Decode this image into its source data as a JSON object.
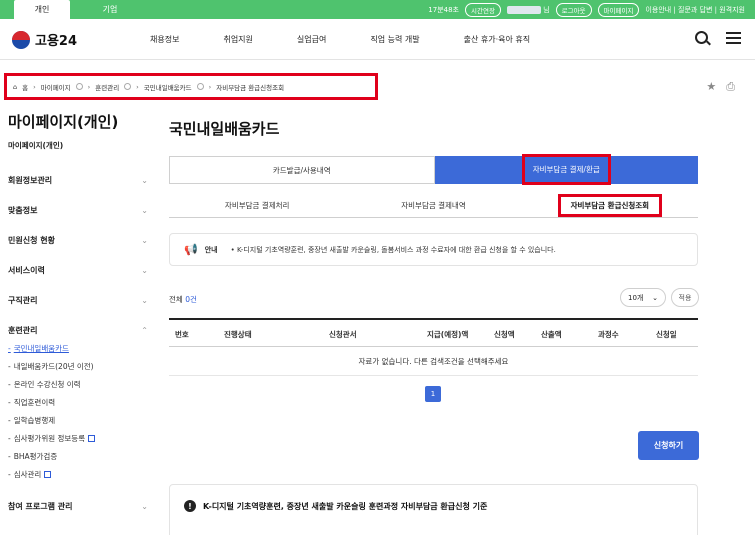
{
  "topbar": {
    "tab_personal": "개인",
    "tab_company": "기업",
    "time_text": "17분48초",
    "extend_label": "시간연장",
    "user_suffix": "님",
    "logout_label": "로그아웃",
    "mypage_label": "마이페이지",
    "links": "이용안내 | 질문과 답변 | 원격지원"
  },
  "header": {
    "logo_text": "고용24",
    "nav": [
      "채용정보",
      "취업지원",
      "실업급여",
      "직업 능력 개발",
      "출산 휴가·육아 휴직"
    ]
  },
  "breadcrumb": {
    "home": "홈",
    "items": [
      "마이페이지",
      "훈련관리",
      "국민내일배움카드",
      "자비부담금 환급신청조회"
    ]
  },
  "sidebar": {
    "title": "마이페이지(개인)",
    "subtitle": "마이페이지(개인)",
    "menu": [
      "회원정보관리",
      "맞춤정보",
      "민원신청 현황",
      "서비스이력",
      "구직관리",
      "훈련관리"
    ],
    "training_items": [
      "국민내일배움카드",
      "내일배움카드(20년 이전)",
      "온라인 수강신청 이력",
      "직업훈련이력",
      "일학습병행제",
      "심사평가위원 정보등록",
      "BHA평가검증",
      "심사관리"
    ],
    "last_menu": "참여 프로그램 관리"
  },
  "main": {
    "title": "국민내일배움카드",
    "seg_tabs": [
      "카드발급/사용내역",
      "자비부담금 결제/환급"
    ],
    "sub_tabs": [
      "자비부담금 결제처리",
      "자비부담금 결제내역",
      "자비부담금 환급신청조회"
    ],
    "notice_label": "안내",
    "notice_text": "• K-디지털 기초역량훈련, 중장년 새출발 카운슬링, 돌봄서비스 과정 수료자에 대한 환급 신청을 할 수 있습니다.",
    "count_prefix": "전체",
    "count_value": "0건",
    "page_size": "10개",
    "apply_label": "적용",
    "columns": [
      "번호",
      "진행상태",
      "신청관서",
      "지급(예정)액",
      "신청액",
      "산출액",
      "과정수",
      "신청일"
    ],
    "empty_text": "자료가 없습니다. 다른 검색조건을 선택해주세요",
    "page": "1",
    "apply_button": "신청하기",
    "criteria_title": "K-디지털 기초역량훈련, 중장년 새출발 카운슬링 훈련과정 자비부담금 환급신청 기준"
  }
}
